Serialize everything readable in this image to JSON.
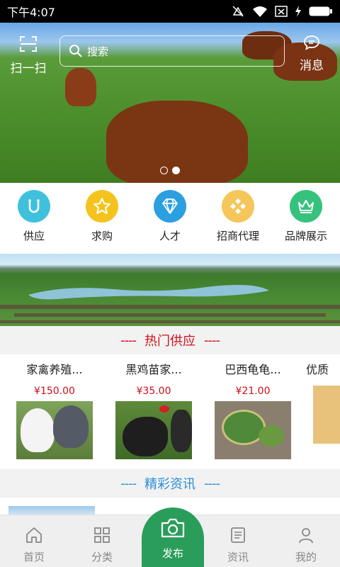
{
  "status_bar": {
    "time": "下午4:07"
  },
  "header": {
    "scan_label": "扫一扫",
    "search_placeholder": "搜索",
    "message_label": "消息"
  },
  "categories": [
    {
      "label": "供应",
      "icon": "supply-icon",
      "color": "#3fc1dd"
    },
    {
      "label": "求购",
      "icon": "star-icon",
      "color": "#f5c31d"
    },
    {
      "label": "人才",
      "icon": "diamond-icon",
      "color": "#2b9fe0"
    },
    {
      "label": "招商代理",
      "icon": "diamond-grid-icon",
      "color": "#f5c65a"
    },
    {
      "label": "品牌展示",
      "icon": "crown-icon",
      "color": "#36c27c"
    }
  ],
  "sections": {
    "hot_supply": "热门供应",
    "news": "精彩资讯",
    "dash": "----",
    "hot_color": "#d0101a",
    "news_color": "#2b8ed8"
  },
  "products": [
    {
      "name": "家禽养殖...",
      "price": "¥150.00"
    },
    {
      "name": "黑鸡苗家...",
      "price": "¥35.00"
    },
    {
      "name": "巴西龟龟...",
      "price": "¥21.00"
    },
    {
      "name": "优质",
      "price": ""
    }
  ],
  "bottom_nav": {
    "home": "首页",
    "category": "分类",
    "publish": "发布",
    "news": "资讯",
    "mine": "我的",
    "accent": "#2a9d5a"
  }
}
